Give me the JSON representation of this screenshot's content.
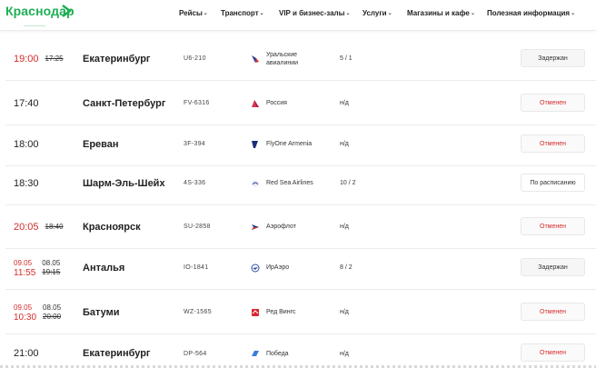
{
  "header": {
    "logo_text": "Краснодар",
    "logo_subtitle": "",
    "nav": [
      {
        "label": "Рейсы"
      },
      {
        "label": "Транспорт"
      },
      {
        "label": "VIP и бизнес-залы"
      },
      {
        "label": "Услуги"
      },
      {
        "label": "Магазины и кафе"
      },
      {
        "label": "Полезная информация"
      }
    ]
  },
  "colors": {
    "brand": "#1fae55",
    "delay_red": "#d42b2b"
  },
  "flights": [
    {
      "date": "",
      "time": "19:00",
      "time_red": true,
      "old_date": "",
      "old_time": "17:25",
      "city": "Екатеринбург",
      "flight": "U6-210",
      "airline": "Уральские авиалинии",
      "airline_icon": "ural-airlines-icon",
      "gate": "5 / 1",
      "status": "Задержан",
      "status_type": "delayed"
    },
    {
      "date": "",
      "time": "17:40",
      "time_red": false,
      "old_date": "",
      "old_time": "",
      "city": "Санкт-Петербург",
      "flight": "FV-6316",
      "airline": "Россия",
      "airline_icon": "rossiya-icon",
      "gate": "н/д",
      "status": "Отменен",
      "status_type": "cancelled"
    },
    {
      "date": "",
      "time": "18:00",
      "time_red": false,
      "old_date": "",
      "old_time": "",
      "city": "Ереван",
      "flight": "3F-394",
      "airline": "FlyOne Armenia",
      "airline_icon": "flyone-icon",
      "gate": "н/д",
      "status": "Отменен",
      "status_type": "cancelled"
    },
    {
      "date": "",
      "time": "18:30",
      "time_red": false,
      "old_date": "",
      "old_time": "",
      "city": "Шарм-Эль-Шейх",
      "flight": "4S-336",
      "airline": "Red Sea Airlines",
      "airline_icon": "red-sea-icon",
      "gate": "10 / 2",
      "status": "По расписанию",
      "status_type": "scheduled"
    },
    {
      "date": "",
      "time": "20:05",
      "time_red": true,
      "old_date": "",
      "old_time": "18:40",
      "city": "Красноярск",
      "flight": "SU-2858",
      "airline": "Аэрофлот",
      "airline_icon": "aeroflot-icon",
      "gate": "н/д",
      "status": "Отменен",
      "status_type": "cancelled"
    },
    {
      "date": "09.05",
      "time": "11:55",
      "time_red": true,
      "old_date": "08.05",
      "old_time": "19:15",
      "city": "Анталья",
      "flight": "IO-1841",
      "airline": "ИрАэро",
      "airline_icon": "iraero-icon",
      "gate": "8 / 2",
      "status": "Задержан",
      "status_type": "delayed"
    },
    {
      "date": "09.05",
      "time": "10:30",
      "time_red": true,
      "old_date": "08.05",
      "old_time": "20:00",
      "city": "Батуми",
      "flight": "WZ-1565",
      "airline": "Ред Вингс",
      "airline_icon": "red-wings-icon",
      "gate": "н/д",
      "status": "Отменен",
      "status_type": "cancelled"
    },
    {
      "date": "",
      "time": "21:00",
      "time_red": false,
      "old_date": "",
      "old_time": "",
      "city": "Екатеринбург",
      "flight": "DP-564",
      "airline": "Победа",
      "airline_icon": "pobeda-icon",
      "gate": "н/д",
      "status": "Отменен",
      "status_type": "cancelled"
    }
  ]
}
